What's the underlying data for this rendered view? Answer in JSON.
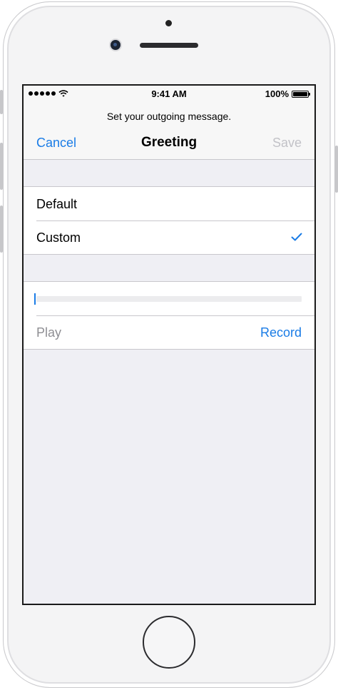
{
  "status_bar": {
    "time": "9:41 AM",
    "battery_percent": "100%",
    "signal_icon": "signal-dots-icon",
    "wifi_icon": "wifi-icon",
    "battery_icon": "battery-icon"
  },
  "nav": {
    "prompt": "Set your outgoing message.",
    "cancel_label": "Cancel",
    "title": "Greeting",
    "save_label": "Save"
  },
  "greeting_options": [
    {
      "label": "Default",
      "selected": false
    },
    {
      "label": "Custom",
      "selected": true
    }
  ],
  "recording": {
    "play_label": "Play",
    "record_label": "Record",
    "progress": 0
  },
  "colors": {
    "accent": "#1a7ce6",
    "disabled": "#c2c2c7",
    "background": "#efeff4"
  }
}
